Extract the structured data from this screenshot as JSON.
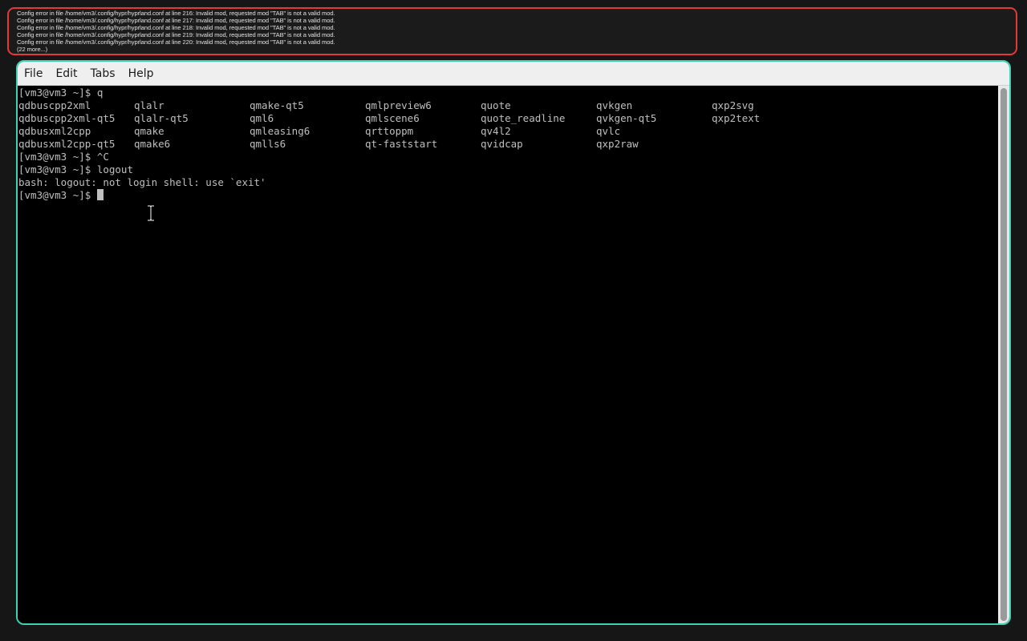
{
  "error_banner": {
    "lines": [
      "Config error in file /home/vm3/.config/hypr/hyprland.conf at line 216: Invalid mod, requested mod \"TAB\" is not a valid mod.",
      "Config error in file /home/vm3/.config/hypr/hyprland.conf at line 217: Invalid mod, requested mod \"TAB\" is not a valid mod.",
      "Config error in file /home/vm3/.config/hypr/hyprland.conf at line 218: Invalid mod, requested mod \"TAB\" is not a valid mod.",
      "Config error in file /home/vm3/.config/hypr/hyprland.conf at line 219: Invalid mod, requested mod \"TAB\" is not a valid mod.",
      "Config error in file /home/vm3/.config/hypr/hyprland.conf at line 220: Invalid mod, requested mod \"TAB\" is not a valid mod.",
      "(22 more...)"
    ],
    "border_color": "#e5383b"
  },
  "terminal": {
    "menu": [
      "File",
      "Edit",
      "Tabs",
      "Help"
    ],
    "border_color": "#3dd3b2",
    "prompt_line_1": "[vm3@vm3 ~]$ q",
    "completion_columns": [
      [
        "qdbuscpp2xml",
        "qdbuscpp2xml-qt5",
        "qdbusxml2cpp",
        "qdbusxml2cpp-qt5"
      ],
      [
        "qlalr",
        "qlalr-qt5",
        "qmake",
        "qmake6"
      ],
      [
        "qmake-qt5",
        "qml6",
        "qmleasing6",
        "qmlls6"
      ],
      [
        "qmlpreview6",
        "qmlscene6",
        "qrttoppm",
        "qt-faststart"
      ],
      [
        "quote",
        "quote_readline",
        "qv4l2",
        "qvidcap"
      ],
      [
        "qvkgen",
        "qvkgen-qt5",
        "qvlc",
        "qxp2raw"
      ],
      [
        "qxp2svg",
        "qxp2text",
        "",
        ""
      ]
    ],
    "prompt_line_2": "[vm3@vm3 ~]$ ^C",
    "prompt_line_3": "[vm3@vm3 ~]$ logout",
    "output_line": "bash: logout: not login shell: use `exit'",
    "prompt_line_4": "[vm3@vm3 ~]$ "
  }
}
